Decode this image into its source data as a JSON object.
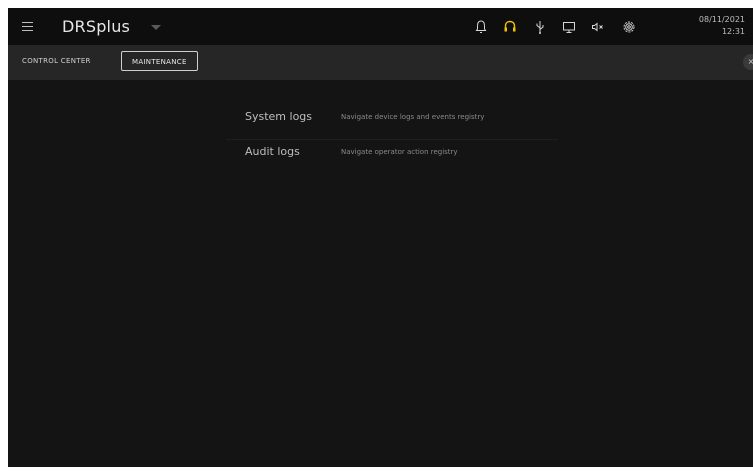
{
  "header": {
    "app_title": "DRSplus",
    "menu_icon": "hamburger-menu-icon",
    "dropdown_icon": "caret-down-icon",
    "icons": [
      "bell-icon",
      "headset-icon",
      "usb-icon",
      "monitor-icon",
      "speaker-muted-icon",
      "gear-icon"
    ],
    "headset_color": "#f2c200",
    "date": "08/11/2021",
    "time": "12:31"
  },
  "tabs": [
    {
      "label": "CONTROL CENTER",
      "active": false
    },
    {
      "label": "MAINTENANCE",
      "active": true
    }
  ],
  "close_label": "×",
  "maintenance_items": [
    {
      "label": "System logs",
      "description": "Navigate device logs and events registry"
    },
    {
      "label": "Audit logs",
      "description": "Navigate operator action registry"
    }
  ]
}
